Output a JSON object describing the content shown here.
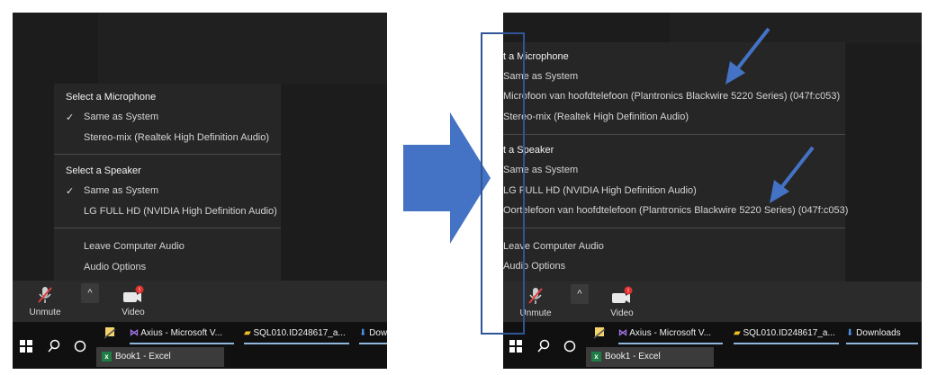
{
  "left": {
    "menu": {
      "mic_header": "Select a Microphone",
      "mic_items": [
        "Same as System",
        "Stereo-mix (Realtek High Definition Audio)"
      ],
      "speaker_header": "Select a Speaker",
      "speaker_items": [
        "Same as System",
        "LG FULL HD (NVIDIA High Definition Audio)"
      ],
      "actions": [
        "Leave Computer Audio",
        "Audio Options"
      ]
    },
    "controls": {
      "unmute": "Unmute",
      "video": "Video",
      "video_badge": "!"
    },
    "taskbar": {
      "apps": [
        "Axius - Microsoft V...",
        "SQL010.ID248617_a...",
        "Dow"
      ],
      "book": "Book1 - Excel"
    }
  },
  "right": {
    "menu": {
      "mic_header": "t a Microphone",
      "mic_items": [
        "Same as System",
        "Microfoon van hoofdtelefoon (Plantronics Blackwire 5220 Series) (047f:c053)",
        "Stereo-mix (Realtek High Definition Audio)"
      ],
      "speaker_header": "t a Speaker",
      "speaker_items": [
        "Same as System",
        "LG FULL HD (NVIDIA High Definition Audio)",
        "Oortelefoon van hoofdtelefoon (Plantronics Blackwire 5220 Series) (047f:c053)"
      ],
      "actions": [
        "Leave Computer Audio",
        "Audio Options"
      ]
    },
    "controls": {
      "unmute": "Unmute",
      "video": "Video",
      "video_badge": "!"
    },
    "taskbar": {
      "apps": [
        "Axius - Microsoft V...",
        "SQL010.ID248617_a...",
        "Downloads"
      ],
      "book": "Book1 - Excel"
    }
  },
  "colors": {
    "arrow": "#4472c4",
    "highlight_border": "#2f5597",
    "underline": "#8fb6dd"
  }
}
